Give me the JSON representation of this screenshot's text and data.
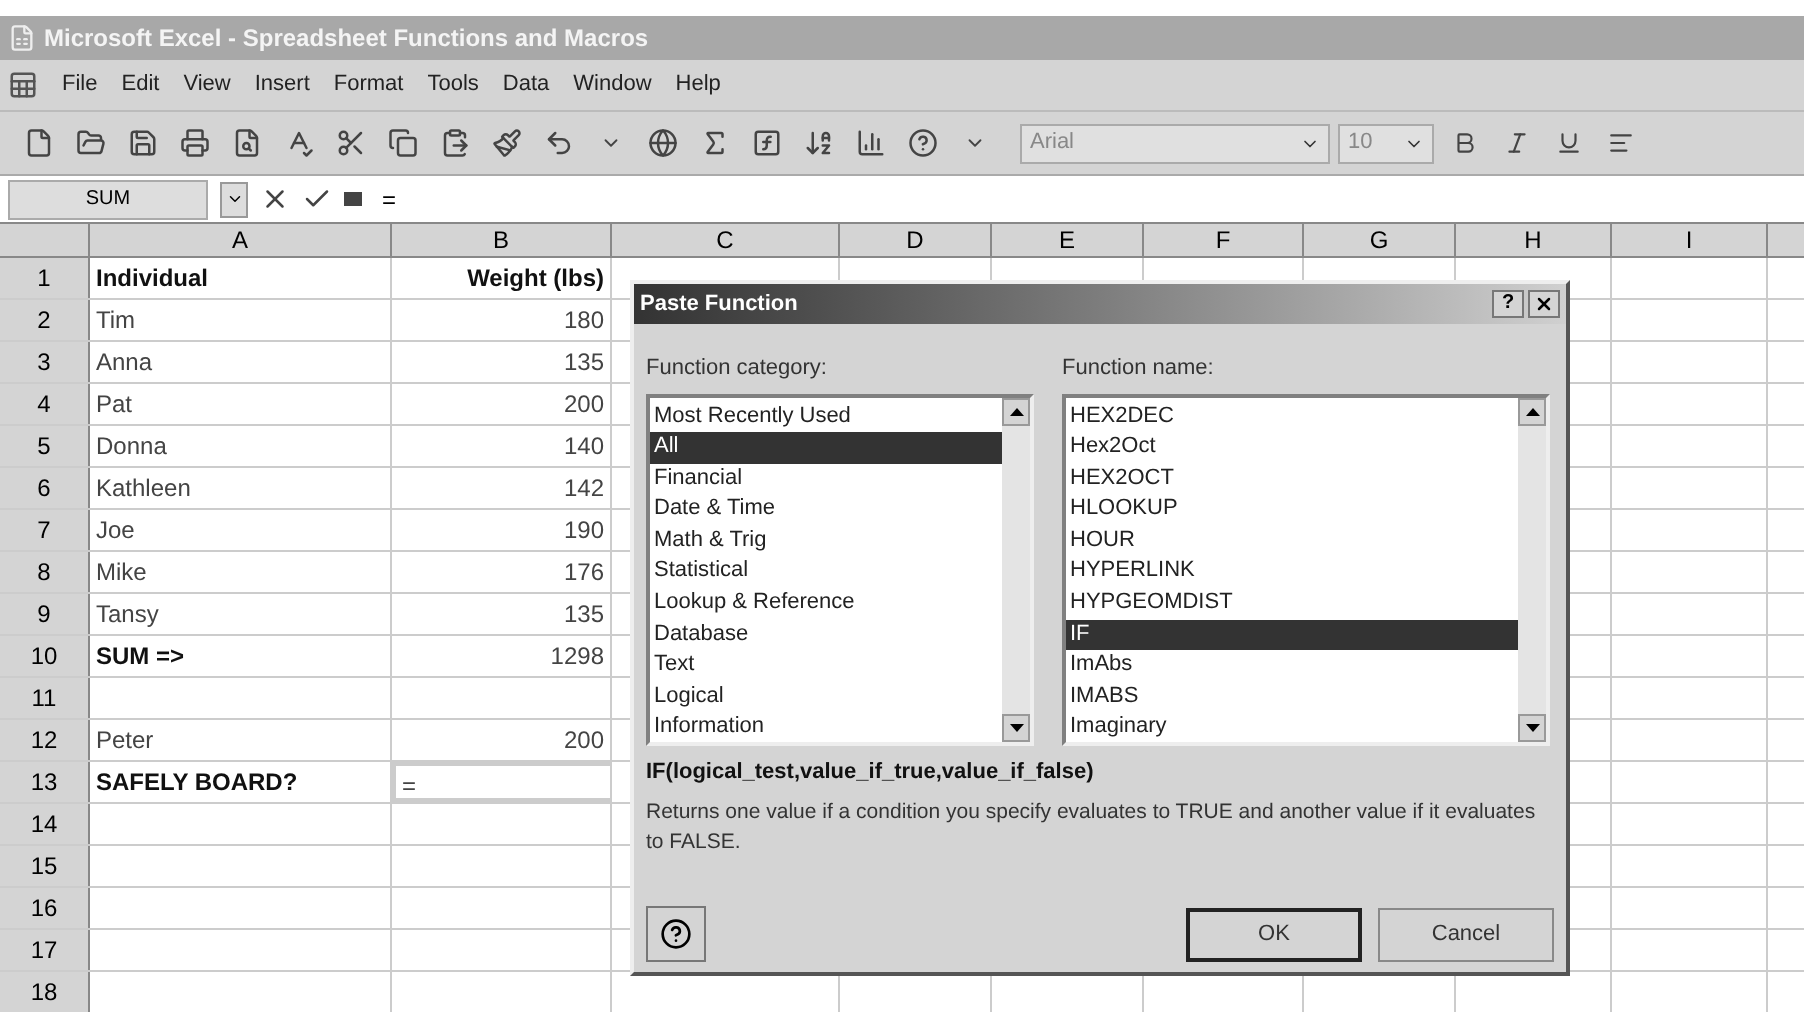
{
  "window": {
    "title": "Microsoft Excel - Spreadsheet  Functions and Macros"
  },
  "menu": [
    "File",
    "Edit",
    "View",
    "Insert",
    "Format",
    "Tools",
    "Data",
    "Window",
    "Help"
  ],
  "toolbar": {
    "font": "Arial",
    "size": "10"
  },
  "formula_bar": {
    "name_box": "SUM",
    "formula": "="
  },
  "columns": [
    "A",
    "B",
    "C",
    "D",
    "E",
    "F",
    "G",
    "H",
    "I"
  ],
  "rows": [
    {
      "number": "1",
      "cells": [
        {
          "text": "Individual",
          "bold": true,
          "selected": false
        },
        {
          "text": "Weight (lbs)",
          "bold": true,
          "selected": false
        }
      ]
    },
    {
      "number": "2",
      "cells": [
        {
          "text": "Tim",
          "bold": false,
          "selected": false
        },
        {
          "text": "180",
          "bold": false,
          "selected": false
        }
      ]
    },
    {
      "number": "3",
      "cells": [
        {
          "text": "Anna",
          "bold": false,
          "selected": false
        },
        {
          "text": "135",
          "bold": false,
          "selected": false
        }
      ]
    },
    {
      "number": "4",
      "cells": [
        {
          "text": "Pat",
          "bold": false,
          "selected": false
        },
        {
          "text": "200",
          "bold": false,
          "selected": false
        }
      ]
    },
    {
      "number": "5",
      "cells": [
        {
          "text": "Donna",
          "bold": false,
          "selected": false
        },
        {
          "text": "140",
          "bold": false,
          "selected": false
        }
      ]
    },
    {
      "number": "6",
      "cells": [
        {
          "text": "Kathleen",
          "bold": false,
          "selected": false
        },
        {
          "text": "142",
          "bold": false,
          "selected": false
        }
      ]
    },
    {
      "number": "7",
      "cells": [
        {
          "text": "Joe",
          "bold": false,
          "selected": false
        },
        {
          "text": "190",
          "bold": false,
          "selected": false
        }
      ]
    },
    {
      "number": "8",
      "cells": [
        {
          "text": "Mike",
          "bold": false,
          "selected": false
        },
        {
          "text": "176",
          "bold": false,
          "selected": false
        }
      ]
    },
    {
      "number": "9",
      "cells": [
        {
          "text": "Tansy",
          "bold": false,
          "selected": false
        },
        {
          "text": "135",
          "bold": false,
          "selected": false
        }
      ]
    },
    {
      "number": "10",
      "cells": [
        {
          "text": "SUM =>",
          "bold": true,
          "selected": false
        },
        {
          "text": "1298",
          "bold": false,
          "selected": false
        }
      ]
    },
    {
      "number": "11",
      "cells": [
        {
          "selected": false
        },
        {
          "selected": false
        }
      ]
    },
    {
      "number": "12",
      "cells": [
        {
          "text": "Peter",
          "bold": false,
          "selected": false
        },
        {
          "text": "200",
          "bold": false,
          "selected": false
        }
      ]
    },
    {
      "number": "13",
      "cells": [
        {
          "text": "SAFELY BOARD?",
          "bold": true,
          "selected": false
        },
        {
          "text": "=",
          "bold": false,
          "selected": true
        }
      ]
    },
    {
      "number": "14",
      "cells": [
        {
          "selected": false
        },
        {
          "selected": false
        }
      ]
    },
    {
      "number": "15",
      "cells": [
        {
          "selected": false
        },
        {
          "selected": false
        }
      ]
    },
    {
      "number": "16",
      "cells": [
        {
          "selected": false
        },
        {
          "selected": false
        }
      ]
    },
    {
      "number": "17",
      "cells": [
        {
          "selected": false
        },
        {
          "selected": false
        }
      ]
    },
    {
      "number": "18",
      "cells": [
        {
          "selected": false
        },
        {
          "selected": false
        }
      ]
    }
  ],
  "dialog": {
    "title": "Paste Function",
    "help_glyph": "?",
    "category_label": "Function category:",
    "categories": [
      {
        "label": "Most Recently Used",
        "selected": false
      },
      {
        "label": "All",
        "selected": true
      },
      {
        "label": "Financial",
        "selected": false
      },
      {
        "label": "Date & Time",
        "selected": false
      },
      {
        "label": "Math & Trig",
        "selected": false
      },
      {
        "label": "Statistical",
        "selected": false
      },
      {
        "label": "Lookup & Reference",
        "selected": false
      },
      {
        "label": "Database",
        "selected": false
      },
      {
        "label": "Text",
        "selected": false
      },
      {
        "label": "Logical",
        "selected": false
      },
      {
        "label": "Information",
        "selected": false
      }
    ],
    "name_label": "Function name:",
    "functions": [
      {
        "label": "HEX2DEC",
        "selected": false
      },
      {
        "label": "Hex2Oct",
        "selected": false
      },
      {
        "label": "HEX2OCT",
        "selected": false
      },
      {
        "label": "HLOOKUP",
        "selected": false
      },
      {
        "label": "HOUR",
        "selected": false
      },
      {
        "label": "HYPERLINK",
        "selected": false
      },
      {
        "label": "HYPGEOMDIST",
        "selected": false
      },
      {
        "label": "IF",
        "selected": true
      },
      {
        "label": "ImAbs",
        "selected": false
      },
      {
        "label": "IMABS",
        "selected": false
      },
      {
        "label": "Imaginary",
        "selected": false
      }
    ],
    "syntax": "IF(logical_test,value_if_true,value_if_false)",
    "description": "Returns one value if a condition you specify evaluates to TRUE and another value if it evaluates to FALSE.",
    "buttons": [
      "OK",
      "Cancel"
    ]
  }
}
